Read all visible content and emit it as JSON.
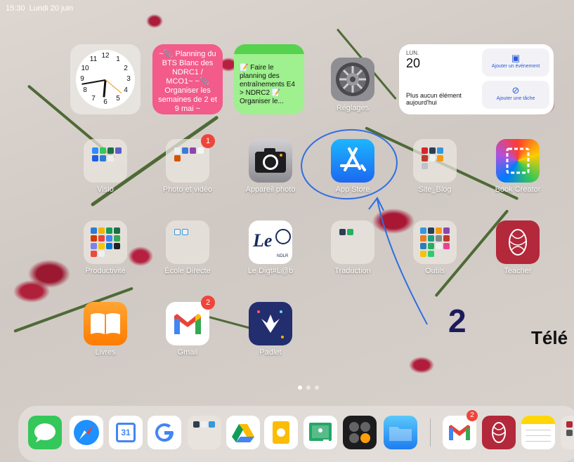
{
  "status": {
    "time": "15:30",
    "date": "Lundi 20 juin"
  },
  "widgets": {
    "clock_numbers": [
      "12",
      "1",
      "2",
      "3",
      "4",
      "5",
      "6",
      "7",
      "8",
      "9",
      "10",
      "11"
    ],
    "note1": "~📎 Planning du BTS Blanc des NDRC1 / MCO1~ ~📎 Organiser les semaines de 2 et 9 mai ~",
    "note2": "📝 Faire le planning des entraînements E4 > NDRC2 📝 Organiser le...",
    "calendar": {
      "month": "LUN.",
      "day": "20",
      "empty": "Plus aucun élément aujourd'hui",
      "add_event": "Ajouter un événement",
      "add_task": "Ajouter une tâche"
    }
  },
  "apps": {
    "reglages": "Réglages",
    "visio": "Visio",
    "photo_video": "Photo et vidéo",
    "appareil_photo": "Appareil photo",
    "app_store": "App Store",
    "site_blog": "Site_Blog",
    "book_creator": "Book Creator",
    "productivite": "Productivité",
    "ecole_directe": "École Directe",
    "le_digit": "Le Digt#L@b",
    "traduction": "Traduction",
    "outils": "Outils",
    "teacher": "Teacher",
    "livres": "Livres",
    "gmail": "Gmail",
    "padlet": "Padlet"
  },
  "badges": {
    "photo_video": "1",
    "gmail": "2",
    "dock_gmail": "2"
  },
  "annotation": {
    "number": "2",
    "cut_text": "Télé"
  },
  "icons": {
    "ledigit_text": "Le",
    "ledigit_sub": "NDLR",
    "calendar_icon": "31"
  },
  "colors": {
    "accent_blue": "#1c74f0",
    "annotation_blue": "#2f6fe0",
    "badge_red": "#f0443a"
  }
}
